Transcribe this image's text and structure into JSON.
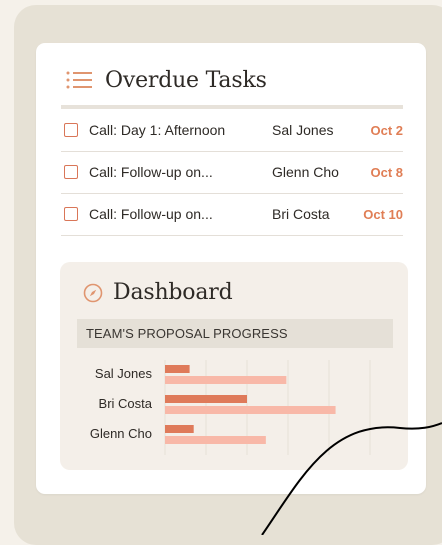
{
  "overdue_tasks": {
    "title": "Overdue Tasks",
    "icon": "list-icon",
    "rows": [
      {
        "task": "Call: Day 1: Afternoon",
        "assignee": "Sal Jones",
        "due": "Oct 2"
      },
      {
        "task": "Call: Follow-up on...",
        "assignee": "Glenn Cho",
        "due": "Oct 8"
      },
      {
        "task": "Call: Follow-up on...",
        "assignee": "Bri Costa",
        "due": "Oct 10"
      }
    ]
  },
  "dashboard": {
    "title": "Dashboard",
    "icon": "compass-icon",
    "section_heading": "TEAM'S PROPOSAL PROGRESS"
  },
  "colors": {
    "accent": "#e07e55",
    "bar_primary": "#df7a5a",
    "bar_secondary": "#f8b8a8"
  },
  "chart_data": {
    "type": "bar",
    "orientation": "horizontal",
    "categories": [
      "Sal Jones",
      "Bri Costa",
      "Glenn Cho"
    ],
    "series": [
      {
        "values": [
          3,
          10,
          3.5
        ]
      },
      {
        "values": [
          14.8,
          20.8,
          12.3
        ]
      }
    ],
    "xlim": [
      0,
      25
    ],
    "grid": true,
    "legend": "none"
  }
}
